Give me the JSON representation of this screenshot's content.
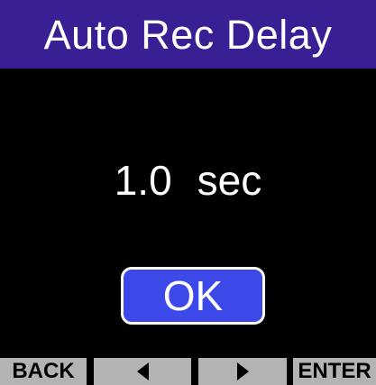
{
  "colors": {
    "title_bar": "#3a1f94",
    "background": "#000000",
    "ok_button": "#3d48e8",
    "softkey": "#b3b3b3",
    "text": "#ffffff"
  },
  "title": "Auto Rec Delay",
  "setting": {
    "value": "1.0",
    "unit": "sec"
  },
  "ok_button": {
    "label": "OK"
  },
  "softkeys": {
    "back": "BACK",
    "left_icon": "left-arrow-icon",
    "right_icon": "right-arrow-icon",
    "enter": "ENTER"
  }
}
